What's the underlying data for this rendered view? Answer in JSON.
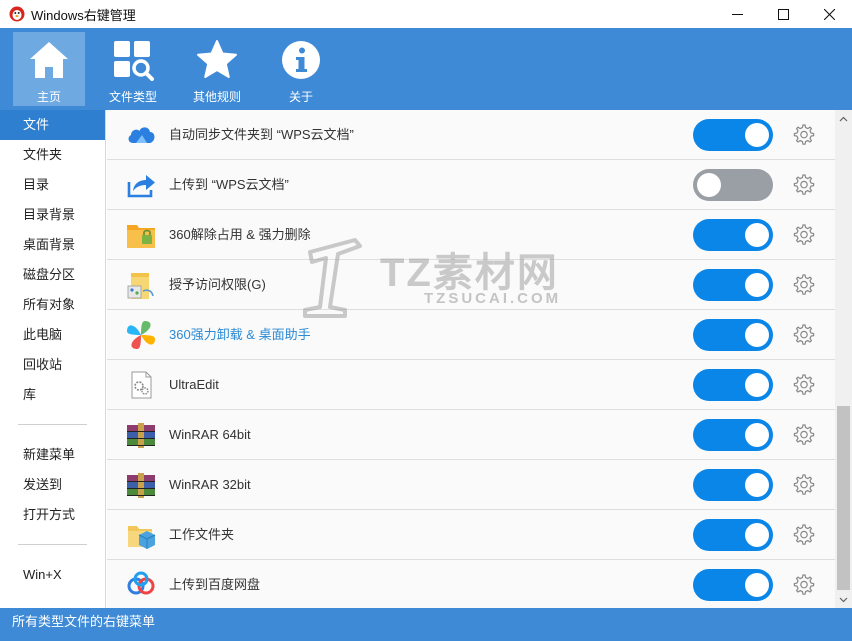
{
  "window": {
    "title": "Windows右键管理",
    "icon": "app-logo-icon"
  },
  "toolbar": {
    "items": [
      {
        "label": "主页",
        "icon": "home-icon",
        "active": true
      },
      {
        "label": "文件类型",
        "icon": "grid-search-icon",
        "active": false
      },
      {
        "label": "其他规则",
        "icon": "star-icon",
        "active": false
      },
      {
        "label": "关于",
        "icon": "info-icon",
        "active": false
      }
    ]
  },
  "sidebar": {
    "items": [
      {
        "label": "文件",
        "active": true
      },
      {
        "label": "文件夹"
      },
      {
        "label": "目录"
      },
      {
        "label": "目录背景"
      },
      {
        "label": "桌面背景"
      },
      {
        "label": "磁盘分区"
      },
      {
        "label": "所有对象"
      },
      {
        "label": "此电脑"
      },
      {
        "label": "回收站"
      },
      {
        "label": "库"
      }
    ],
    "items2": [
      {
        "label": "新建菜单"
      },
      {
        "label": "发送到"
      },
      {
        "label": "打开方式"
      }
    ],
    "items3": [
      {
        "label": "Win+X"
      }
    ]
  },
  "list": {
    "rows": [
      {
        "label": "自动同步文件夹到 “WPS云文档”",
        "icon": "cloud-icon",
        "enabled": true
      },
      {
        "label": "上传到 “WPS云文档”",
        "icon": "share-arrow-icon",
        "enabled": false
      },
      {
        "label": "360解除占用 & 强力删除",
        "icon": "folder-lock-icon",
        "enabled": true
      },
      {
        "label": "授予访问权限(G)",
        "icon": "share-folder-icon",
        "enabled": true
      },
      {
        "label": "360强力卸载 & 桌面助手",
        "icon": "colorful-flower-icon",
        "enabled": true,
        "link": true
      },
      {
        "label": "UltraEdit",
        "icon": "document-gear-icon",
        "enabled": true
      },
      {
        "label": "WinRAR 64bit",
        "icon": "winrar-books-icon",
        "enabled": true
      },
      {
        "label": "WinRAR 32bit",
        "icon": "winrar-books-icon",
        "enabled": true
      },
      {
        "label": "工作文件夹",
        "icon": "work-folder-icon",
        "enabled": true
      },
      {
        "label": "上传到百度网盘",
        "icon": "baidu-cloud-icon",
        "enabled": true
      }
    ]
  },
  "watermark": {
    "big": "TZ素材网",
    "small": "TZSUCAI.COM"
  },
  "status": {
    "text": "所有类型文件的右键菜单"
  },
  "colors": {
    "accent": "#3f8ad6",
    "toggle_on": "#0a86e8",
    "toggle_off": "#9a9fa6",
    "sidebar_active": "#2f7fd0"
  }
}
